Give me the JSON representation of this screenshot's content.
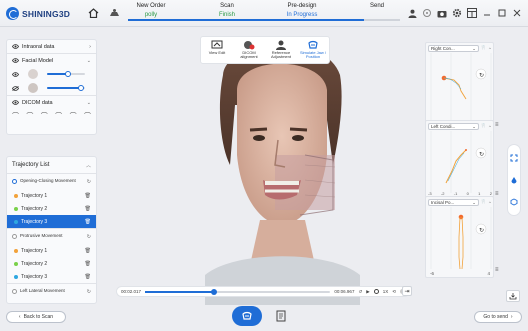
{
  "header": {
    "brand": "SHINING3D",
    "steps": [
      {
        "title": "New Order",
        "status": "polly",
        "state": "user"
      },
      {
        "title": "Scan",
        "status": "Finish",
        "state": "done"
      },
      {
        "title": "Pre-design",
        "status": "In Progress",
        "state": "progress"
      },
      {
        "title": "Send",
        "status": "",
        "state": "pending"
      }
    ]
  },
  "left_panel": {
    "intraoral": {
      "label": "Intraoral data"
    },
    "facial": {
      "label": "Facial Model",
      "slider1": 0.55,
      "slider2": 0.9
    },
    "dicom": {
      "label": "DICOM data"
    }
  },
  "trajectory": {
    "title": "Trajectory List",
    "groups": [
      {
        "label": "Opening-Closing Movement",
        "selected": true,
        "items": [
          {
            "label": "Trajectory 1",
            "color": "#f2a23a"
          },
          {
            "label": "Trajectory 2",
            "color": "#7ad14a"
          },
          {
            "label": "Trajectory 3",
            "color": "#2ea7e0",
            "selected": true
          }
        ]
      },
      {
        "label": "Protrusive Movement",
        "selected": false,
        "items": [
          {
            "label": "Trajectory 1",
            "color": "#f2a23a"
          },
          {
            "label": "Trajectory 2",
            "color": "#7ad14a"
          },
          {
            "label": "Trajectory 3",
            "color": "#2ea7e0"
          }
        ]
      },
      {
        "label": "Left Lateral Movement",
        "selected": false,
        "items": []
      }
    ]
  },
  "toolbar": {
    "tools": [
      {
        "label": "View Edit",
        "icon": "view-edit-icon"
      },
      {
        "label": "DICOM alignment",
        "icon": "dicom-align-icon"
      },
      {
        "label": "Reference Adjustment",
        "icon": "reference-icon"
      },
      {
        "label": "Simulate Jaw / Position",
        "icon": "simulate-jaw-icon",
        "active": true
      }
    ]
  },
  "graphs": [
    {
      "title": "Right Con...",
      "ticks": [
        "",
        "",
        "",
        ""
      ],
      "axis_min": "",
      "axis_max": ""
    },
    {
      "title": "Left Condi...",
      "ticks": [
        "-3",
        "-2",
        "-1",
        "0",
        "1",
        "2"
      ],
      "axis_min": "",
      "axis_max": ""
    },
    {
      "title": "Incisal Po...",
      "ticks": [
        "-6",
        "4"
      ],
      "axis_min": "-6",
      "axis_max": "4"
    }
  ],
  "playback": {
    "current": "00:02.017",
    "total": "00:06.967",
    "progress": 0.37,
    "speed": "1X"
  },
  "footer": {
    "back_label": "Back to Scan",
    "next_label": "Go to send"
  }
}
